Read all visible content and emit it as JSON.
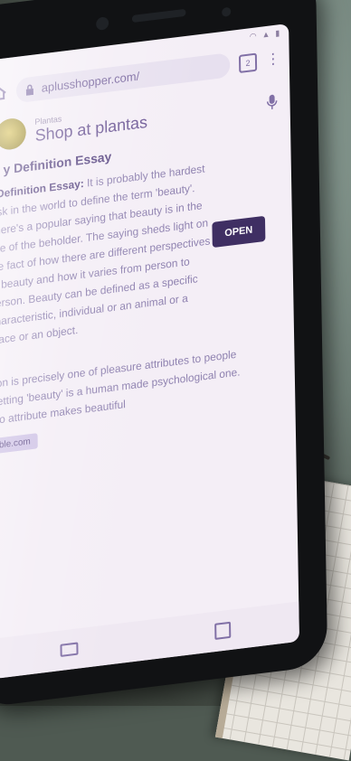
{
  "browser": {
    "url": "aplusshopper.com/",
    "tab_count": "2"
  },
  "ad": {
    "sponsor_label": "Plantas",
    "title": "Shop at plantas",
    "open_label": "OPEN"
  },
  "article": {
    "heading": "y Definition Essay",
    "paragraph1_bold": "y Definition Essay:",
    "paragraph1": " It is probably the hardest task in the world to define the term 'beauty'. There's a popular saying that beauty is in the eye of the beholder. The saying sheds light on the fact of how there are different perspectives of beauty and how it varies from person to person. Beauty can be defined as a specific characteristic, individual or an animal or a place or an object.",
    "paragraph2": "tion is precisely one of pleasure attributes to people getting 'beauty' is a human made psychological one. No attribute makes beautiful",
    "chip": "ble.com"
  },
  "colors": {
    "accent": "#3f2f63",
    "link": "#7c6aa1",
    "screen": "#f4eef6"
  }
}
